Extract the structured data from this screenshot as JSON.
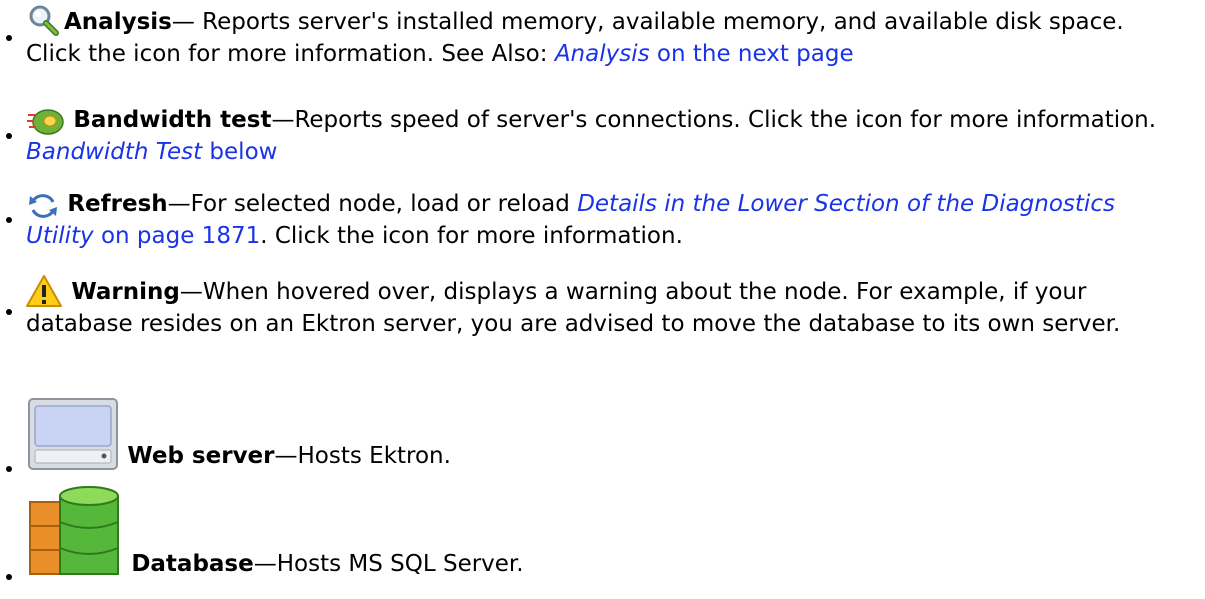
{
  "items": [
    {
      "icon": "magnifier-icon",
      "title": "Analysis",
      "sep": "— ",
      "desc": "Reports server's installed memory, available memory, and available disk space. Click the icon for more information. See Also: ",
      "link_italic": "Analysis",
      "link_rest": "  on the next page",
      "after": ""
    },
    {
      "icon": "bandwidth-icon",
      "title": "Bandwidth test",
      "sep": "—",
      "desc": "Reports speed of server's connections. Click the icon for more information. ",
      "link_italic": "Bandwidth Test",
      "link_rest": " below",
      "after": ""
    },
    {
      "icon": "refresh-icon",
      "title": "Refresh",
      "sep": "—",
      "desc": "For selected node, load or reload ",
      "link_italic": "Details in the Lower Section of the Diagnostics Utility",
      "link_rest": " on page 1871",
      "after": ". Click the icon for more information."
    },
    {
      "icon": "warning-icon",
      "title": "Warning",
      "sep": "—",
      "desc": "When hovered over, displays a warning about the node. For example, if your database resides on an Ektron server, you are advised to move the database to its own server.",
      "link_italic": "",
      "link_rest": "",
      "after": ""
    },
    {
      "icon": "web-server-icon",
      "title": "Web server",
      "sep": "—",
      "desc": "Hosts Ektron.",
      "link_italic": "",
      "link_rest": "",
      "after": ""
    },
    {
      "icon": "database-icon",
      "title": "Database",
      "sep": "—",
      "desc": "Hosts MS SQL Server.",
      "link_italic": "",
      "link_rest": "",
      "after": ""
    }
  ],
  "colors": {
    "link": "#1a33e6",
    "text": "#000000"
  }
}
